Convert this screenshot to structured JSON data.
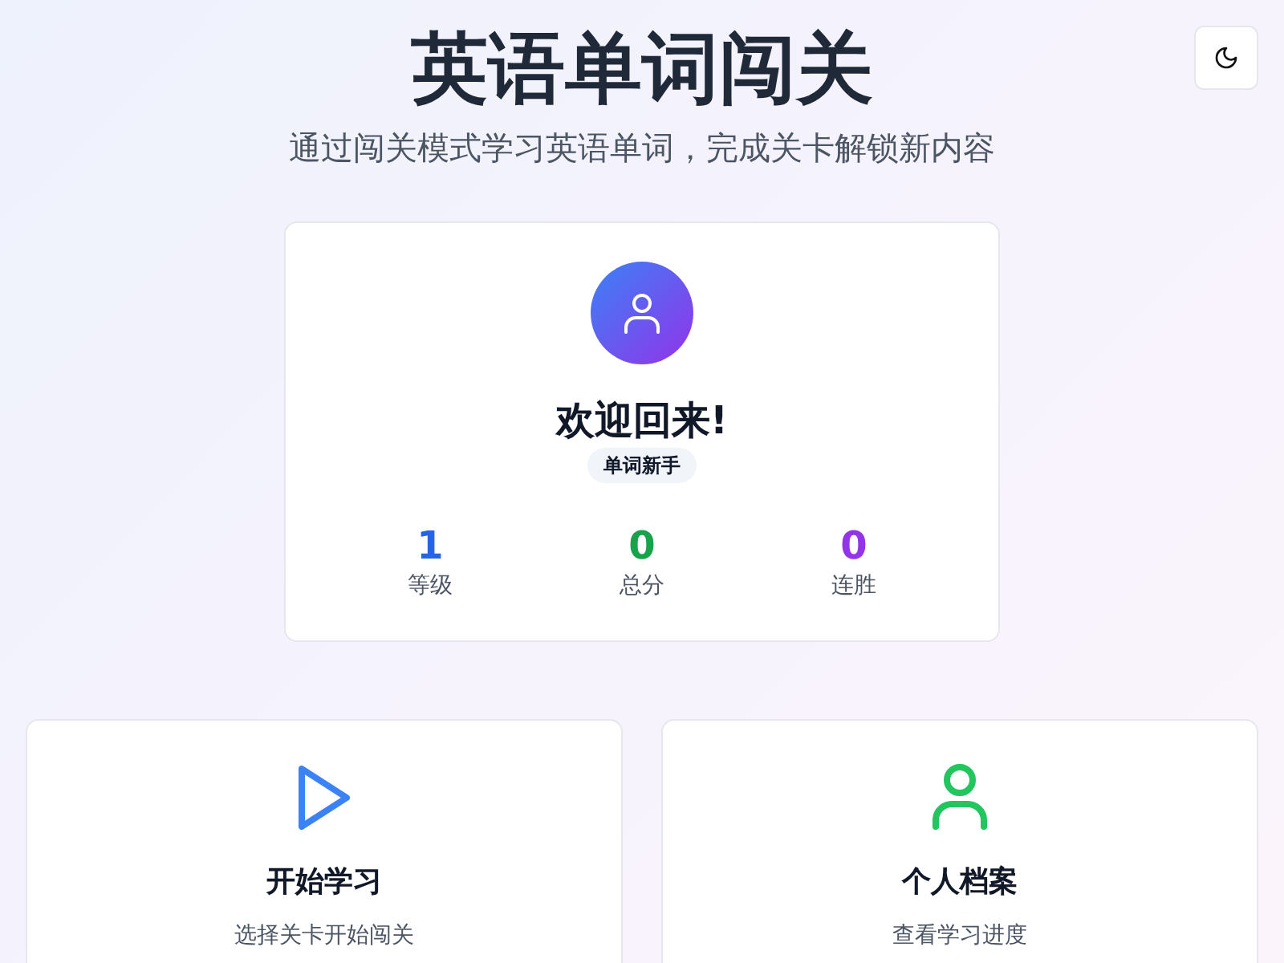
{
  "header": {
    "title": "英语单词闯关",
    "subtitle": "通过闯关模式学习英语单词，完成关卡解锁新内容",
    "theme_toggle": {
      "dark": false
    }
  },
  "profile": {
    "greeting": "欢迎回来!",
    "rank": "单词新手",
    "stats": [
      {
        "value": "1",
        "label": "等级",
        "color": "#2563eb"
      },
      {
        "value": "0",
        "label": "总分",
        "color": "#16a34a"
      },
      {
        "value": "0",
        "label": "连胜",
        "color": "#9333ea"
      }
    ]
  },
  "actions": [
    {
      "kind": "play",
      "title": "开始学习",
      "description": "选择关卡开始闯关",
      "color": "#3b82f6"
    },
    {
      "kind": "person",
      "title": "个人档案",
      "description": "查看学习进度",
      "color": "#22c55e"
    }
  ]
}
